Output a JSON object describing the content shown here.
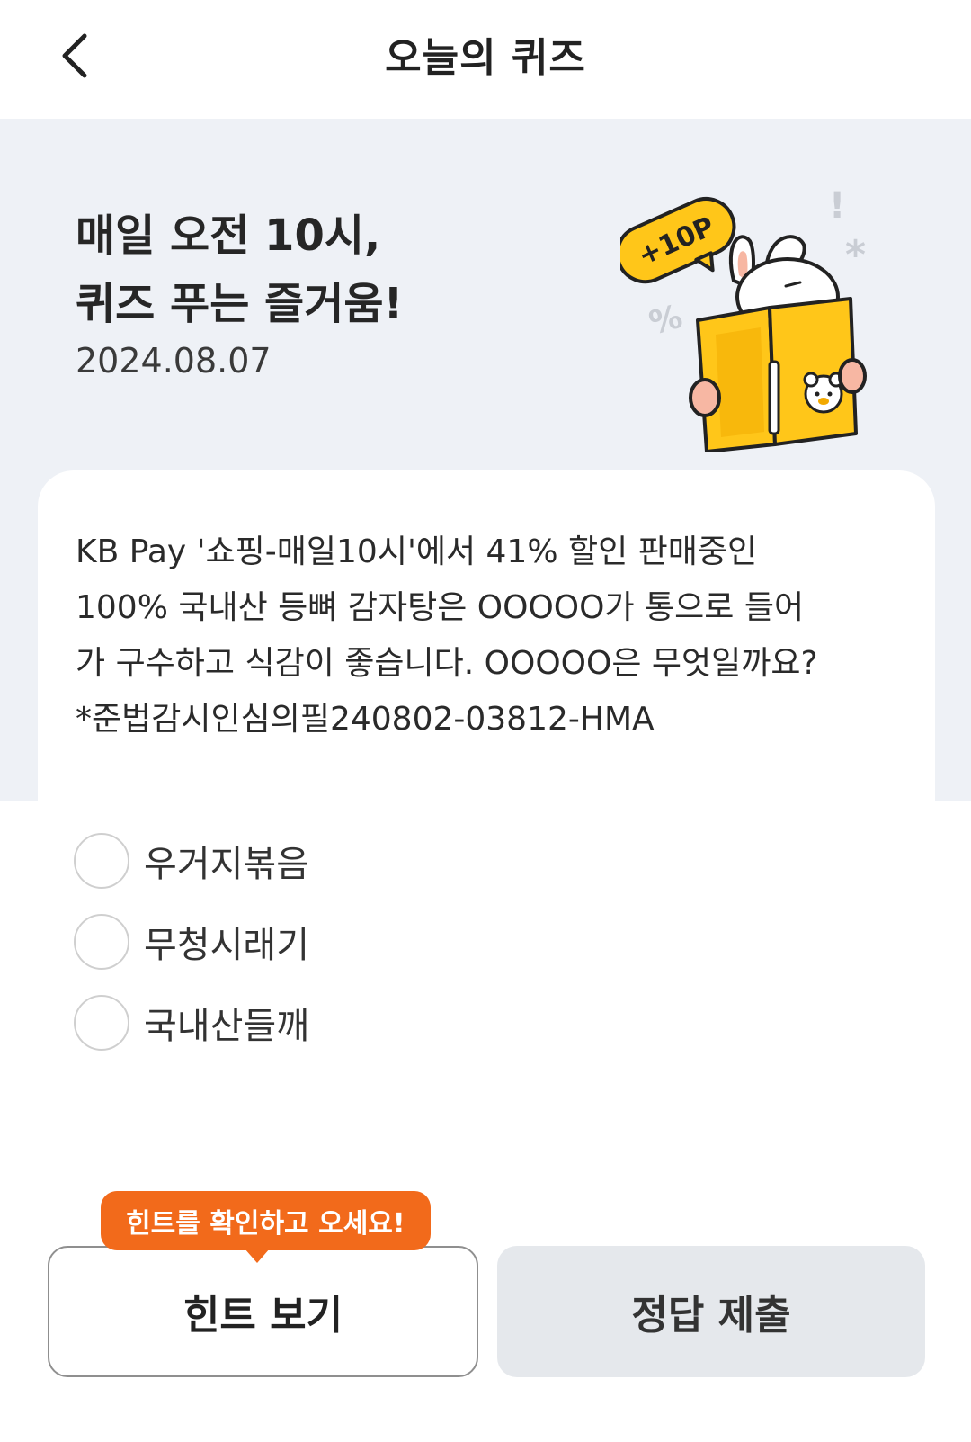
{
  "header": {
    "title": "오늘의 퀴즈",
    "back_icon": "chevron-left-icon"
  },
  "hero": {
    "line1": "매일 오전 10시,",
    "line2": "퀴즈 푸는 즐거움!",
    "date": "2024.08.07",
    "badge_text": "+10P",
    "accent_color": "#ffc619"
  },
  "question": {
    "lines": [
      "KB Pay '쇼핑-매일10시'에서 41% 할인 판매중인",
      "100% 국내산 등뼈 감자탕은 OOOOO가 통으로 들어",
      "가 구수하고 식감이 좋습니다. OOOOO은 무엇일까요?",
      "*준법감시인심의필240802-03812-HMA"
    ]
  },
  "options": [
    {
      "label": "우거지볶음"
    },
    {
      "label": "무청시래기"
    },
    {
      "label": "국내산들깨"
    }
  ],
  "tooltip": {
    "text": "힌트를 확인하고 오세요!",
    "color": "#f26a1b"
  },
  "buttons": {
    "hint_label": "힌트 보기",
    "submit_label": "정답 제출"
  }
}
